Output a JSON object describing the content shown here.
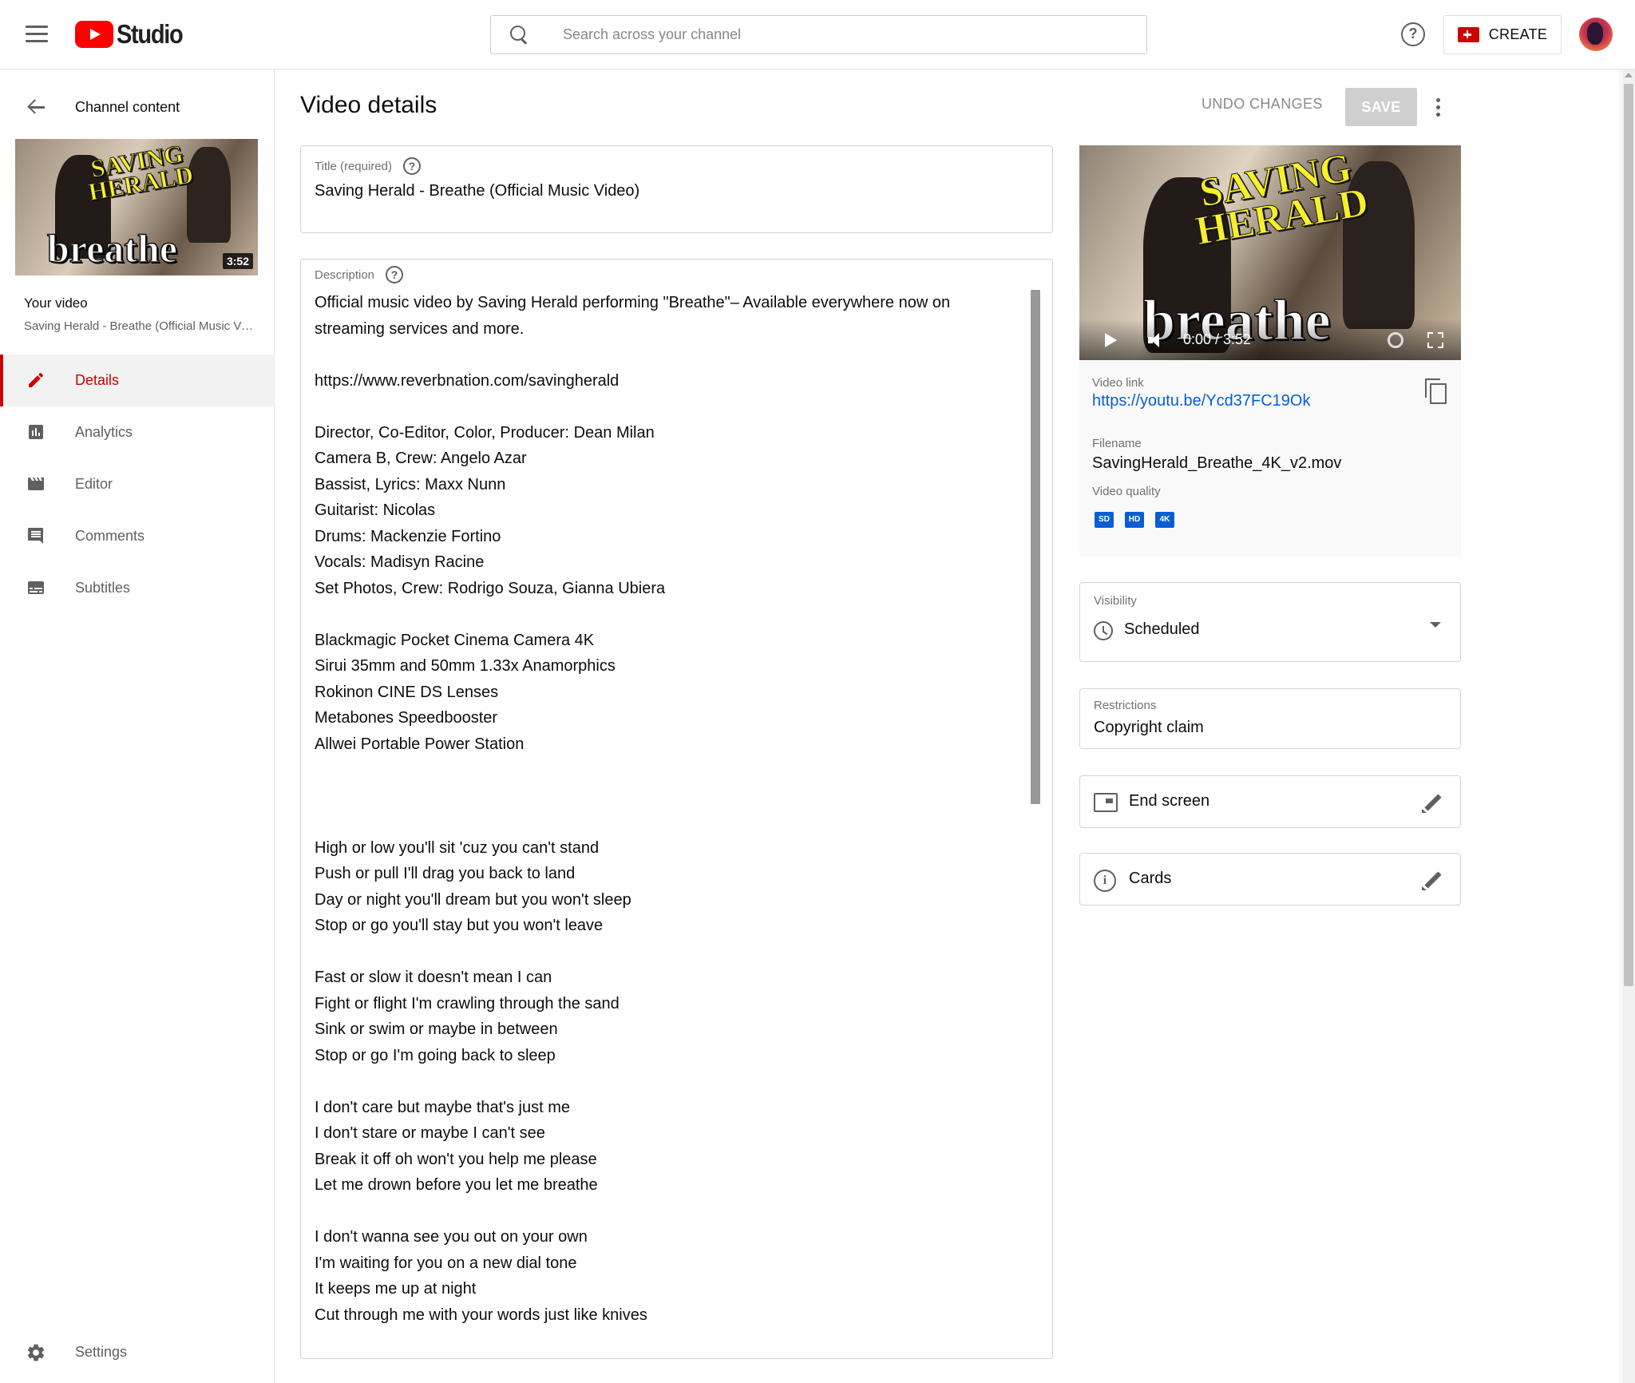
{
  "header": {
    "logo_text": "Studio",
    "search_placeholder": "Search across your channel",
    "help_glyph": "?",
    "create_label": "CREATE"
  },
  "sidebar": {
    "back_label": "Channel content",
    "thumbnail": {
      "art_title": "SAVING HERALD",
      "art_word": "breathe",
      "duration": "3:52"
    },
    "your_video_label": "Your video",
    "video_title": "Saving Herald - Breathe (Official Music Video)",
    "items": [
      {
        "label": "Details",
        "icon": "pencil-icon",
        "active": true
      },
      {
        "label": "Analytics",
        "icon": "analytics-icon",
        "active": false
      },
      {
        "label": "Editor",
        "icon": "clapperboard-icon",
        "active": false
      },
      {
        "label": "Comments",
        "icon": "comment-icon",
        "active": false
      },
      {
        "label": "Subtitles",
        "icon": "subtitles-icon",
        "active": false
      }
    ],
    "settings_label": "Settings"
  },
  "main": {
    "page_title": "Video details",
    "undo_label": "UNDO CHANGES",
    "save_label": "SAVE",
    "title_field": {
      "label": "Title (required)",
      "value": "Saving Herald - Breathe (Official Music Video)"
    },
    "description_field": {
      "label": "Description",
      "value": "Official music video by Saving Herald performing \"Breathe\"– Available everywhere now on\nstreaming services and more.\n\nhttps://www.reverbnation.com/savingherald\n\nDirector, Co-Editor, Color, Producer: Dean Milan\nCamera B, Crew: Angelo Azar\nBassist, Lyrics: Maxx Nunn\nGuitarist: Nicolas\nDrums: Mackenzie Fortino\nVocals: Madisyn Racine\nSet Photos, Crew: Rodrigo Souza, Gianna Ubiera\n\nBlackmagic Pocket Cinema Camera 4K\nSirui 35mm and 50mm 1.33x Anamorphics\nRokinon CINE DS Lenses\nMetabones Speedbooster\nAllwei Portable Power Station\n\n\n\nHigh or low you'll sit 'cuz you can't stand\nPush or pull I'll drag you back to land\nDay or night you'll dream but you won't sleep\nStop or go you'll stay but you won't leave\n\nFast or slow it doesn't mean I can\nFight or flight I'm crawling through the sand\nSink or swim or maybe in between\nStop or go I'm going back to sleep\n\nI don't care but maybe that's just me\nI don't stare or maybe I can't see\nBreak it off oh won't you help me please\nLet me drown before you let me breathe\n\nI don't wanna see you out on your own\nI'm waiting for you on a new dial tone\nIt keeps me up at night\nCut through me with your words just like knives"
    }
  },
  "right": {
    "player": {
      "art_title": "SAVING HERALD",
      "art_word": "breathe",
      "time": "0:00 / 3:52"
    },
    "video_link_label": "Video link",
    "video_link": "https://youtu.be/Ycd37FC19Ok",
    "filename_label": "Filename",
    "filename": "SavingHerald_Breathe_4K_v2.mov",
    "quality_label": "Video quality",
    "quality_badges": [
      "SD",
      "HD",
      "4K"
    ],
    "visibility_label": "Visibility",
    "visibility_value": "Scheduled",
    "restrictions_label": "Restrictions",
    "restrictions_value": "Copyright claim",
    "end_screen_label": "End screen",
    "cards_label": "Cards",
    "info_glyph": "i"
  },
  "colors": {
    "accent": "#cc0000",
    "link": "#065fd4",
    "youtube_red": "#ff0000"
  }
}
